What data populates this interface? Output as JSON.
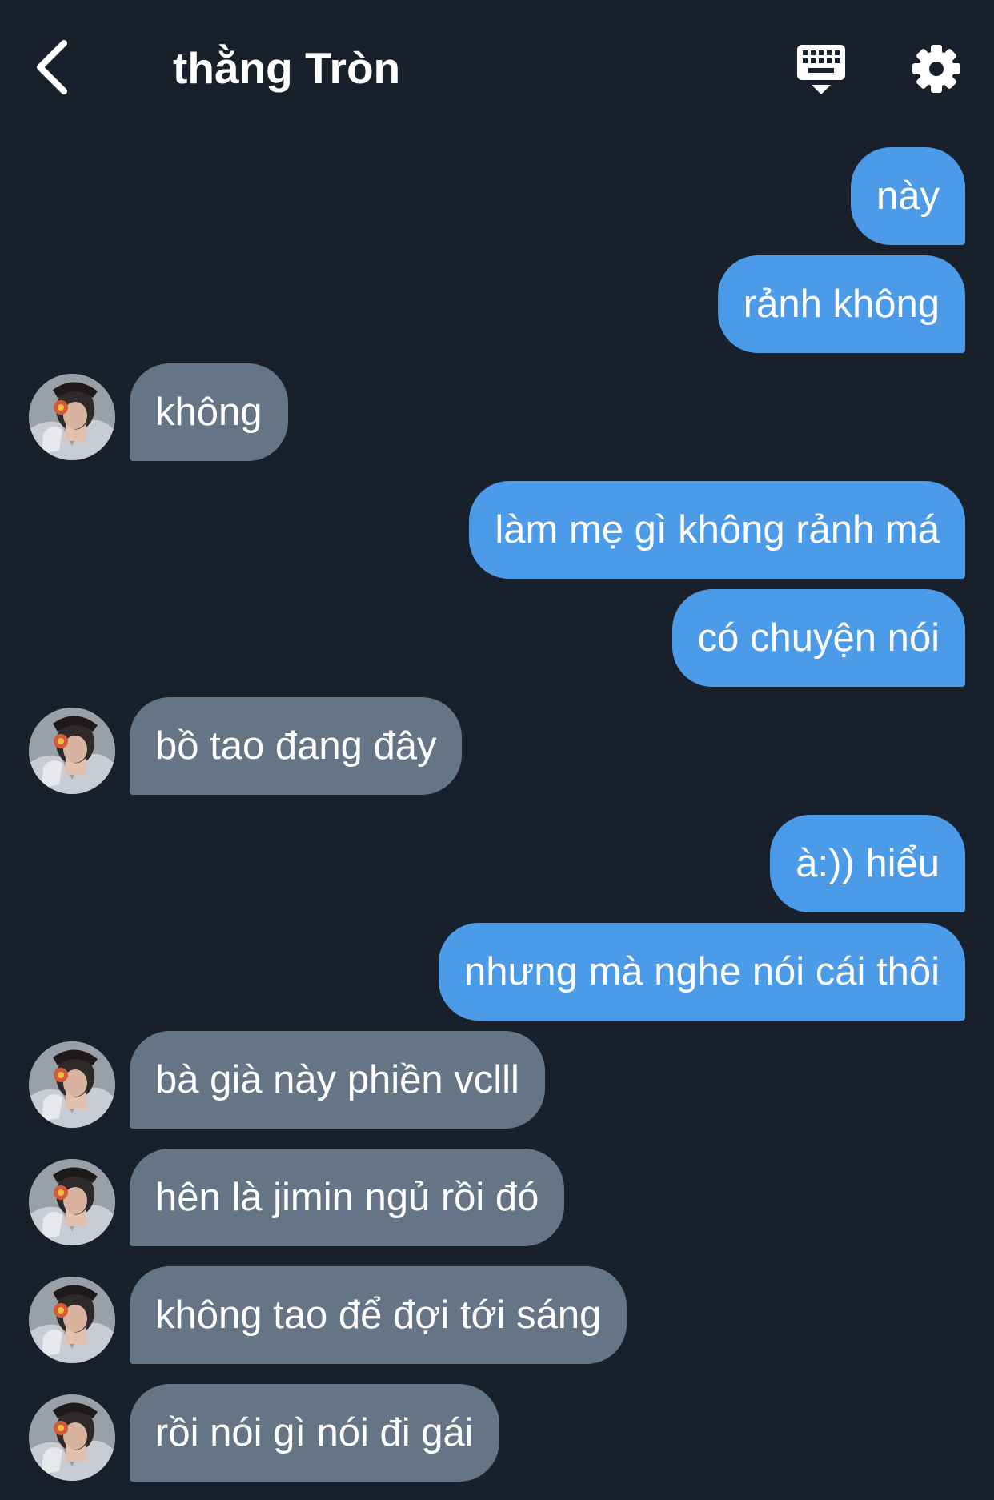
{
  "header": {
    "title": "thằng Tròn",
    "back_icon": "chevron-left-icon",
    "keyboard_icon": "keyboard-icon",
    "settings_icon": "gear-icon"
  },
  "colors": {
    "background": "#18202c",
    "outgoing_bubble": "#4c9be8",
    "incoming_bubble": "#667585",
    "text": "#ffffff"
  },
  "messages": [
    {
      "dir": "out",
      "text": "này"
    },
    {
      "dir": "out",
      "text": "rảnh không"
    },
    {
      "dir": "in",
      "text": "không"
    },
    {
      "dir": "out",
      "text": "làm mẹ gì không rảnh má"
    },
    {
      "dir": "out",
      "text": "có chuyện nói"
    },
    {
      "dir": "in",
      "text": "bồ tao đang đây"
    },
    {
      "dir": "out",
      "text": "à:)) hiểu"
    },
    {
      "dir": "out",
      "text": "nhưng mà nghe nói cái thôi"
    },
    {
      "dir": "in",
      "text": "bà già này phiền vclll"
    },
    {
      "dir": "in",
      "text": "hên là jimin ngủ rồi đó"
    },
    {
      "dir": "in",
      "text": "không tao để đợi tới sáng"
    },
    {
      "dir": "in",
      "text": "rồi nói gì nói đi gái"
    }
  ]
}
